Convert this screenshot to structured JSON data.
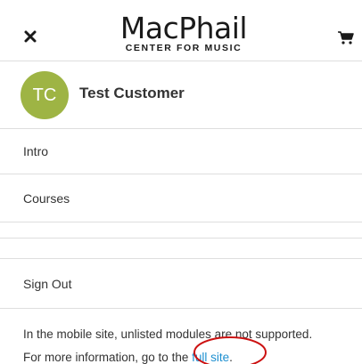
{
  "header": {
    "close_icon": "close-icon",
    "logo_main": "MacPhail",
    "logo_sub": "CENTER FOR MUSIC",
    "cart_icon": "cart-icon"
  },
  "user": {
    "initials": "TC",
    "name": "Test Customer",
    "avatar_color": "#9eb444"
  },
  "menu": {
    "items": [
      {
        "label": "Intro"
      },
      {
        "label": "Courses"
      },
      {
        "label": ""
      },
      {
        "label": ""
      },
      {
        "label": "Sign Out"
      }
    ]
  },
  "note": {
    "line1": "In the mobile site, unlisted modules are not supported.",
    "line2_prefix": "For more information, go to the ",
    "link_text": "full site",
    "line2_suffix": ".",
    "link_color": "#1d8fd0",
    "annotation_color": "#cc1111"
  }
}
